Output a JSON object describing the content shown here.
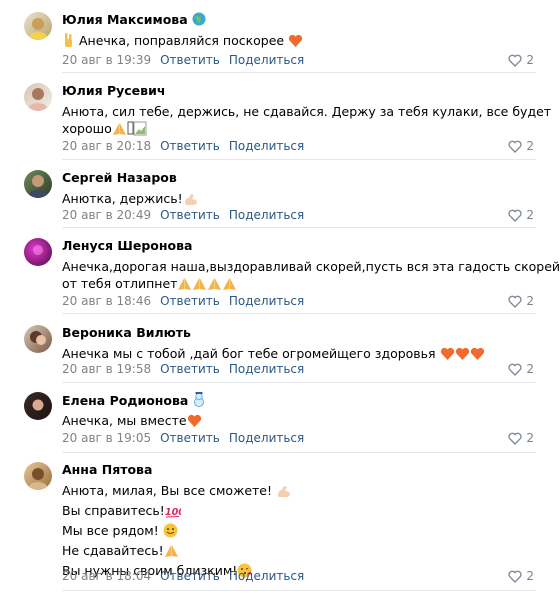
{
  "actions": {
    "reply": "Ответить",
    "share": "Поделиться"
  },
  "colors": {
    "link": "#2a5885",
    "muted": "#828282",
    "divider": "#e7e8ec",
    "heart": "#e64646",
    "like_icon": "#818c99"
  },
  "comments": [
    {
      "author": "Юлия Максимова",
      "badge_icon": "globe-icon",
      "lines": [
        "Анечка, поправляйся поскорее"
      ],
      "emojis": [
        "victory-hand-icon",
        "orange-heart-icon"
      ],
      "date": "20 авг в 19:39",
      "likes": "2"
    },
    {
      "author": "Юлия Русевич",
      "lines": [
        "Анюта, сил тебе, держись, не сдавайся. Держу за тебя кулаки, все будет",
        "хорошо"
      ],
      "emojis": [
        "praying-hands-icon",
        "broken-image-icon"
      ],
      "date": "20 авг в 20:18",
      "likes": "2"
    },
    {
      "author": "Сергей Назаров",
      "lines": [
        "Анютка, держись!"
      ],
      "emojis": [
        "flexed-biceps-icon"
      ],
      "date": "20 авг в 20:49",
      "likes": "2"
    },
    {
      "author": "Ленуся Шеронова",
      "lines": [
        "Анечка,дорогая наша,выздоравливай скорей,пусть вся эта гадость скорей",
        "от тебя отлипнет"
      ],
      "emojis": [
        "praying-hands-icon"
      ],
      "date": "20 авг в 18:46",
      "likes": "2"
    },
    {
      "author": "Вероника Вилють",
      "lines": [
        "Анечка мы с тобой ,дай бог тебе огромейщего здоровья"
      ],
      "emojis": [
        "orange-heart-icon"
      ],
      "date": "20 авг в 19:58",
      "likes": "2"
    },
    {
      "author": "Елена Родионова",
      "badge_icon": "snowman-icon",
      "lines": [
        "Анечка, мы вместе"
      ],
      "emojis": [
        "orange-heart-icon"
      ],
      "date": "20 авг в 19:05",
      "likes": "2"
    },
    {
      "author": "Анна Пятова",
      "lines": [
        "Анюта, милая, Вы все сможете!",
        "Вы справитесь!",
        "Мы все рядом!",
        "Не сдавайтесь!",
        "Вы нужны своим близким!"
      ],
      "emojis": [
        "flexed-biceps-icon",
        "hundred-points-icon",
        "smiling-face-icon",
        "praying-hands-icon",
        "kissing-face-icon"
      ],
      "date": "20 авг в 18:04",
      "likes": "2"
    }
  ]
}
